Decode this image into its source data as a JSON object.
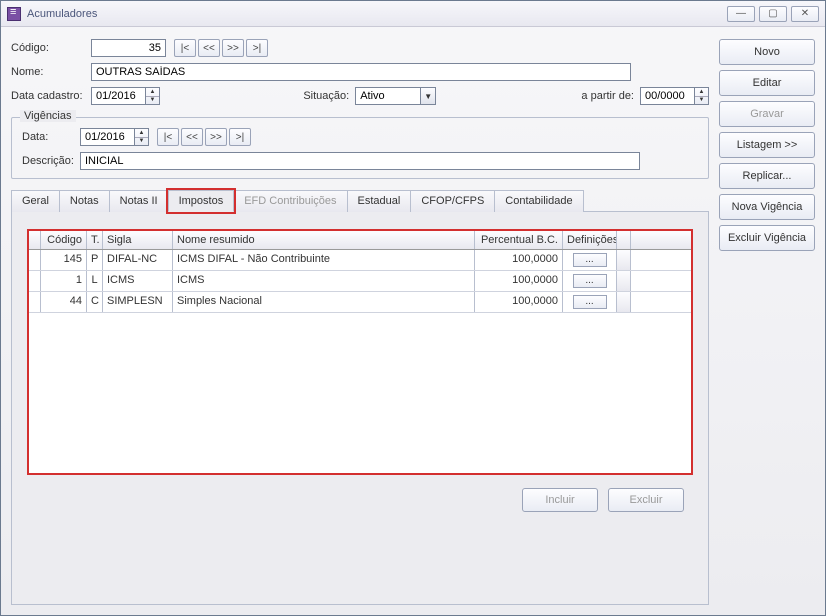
{
  "window": {
    "title": "Acumuladores"
  },
  "buttons": {
    "novo": "Novo",
    "editar": "Editar",
    "gravar": "Gravar",
    "listagem": "Listagem >>",
    "replicar": "Replicar...",
    "nova_vig": "Nova Vigência",
    "excluir_vig": "Excluir Vigência",
    "incluir": "Incluir",
    "excluir": "Excluir"
  },
  "nav": {
    "first": "|<",
    "prev": "<<",
    "next": ">>",
    "last": ">|"
  },
  "form": {
    "codigo_label": "Código:",
    "codigo": "35",
    "nome_label": "Nome:",
    "nome": "OUTRAS SAÍDAS",
    "data_cad_label": "Data cadastro:",
    "data_cad": "01/2016",
    "situacao_label": "Situação:",
    "situacao": "Ativo",
    "apartir_label": "a partir de:",
    "apartir": "00/0000"
  },
  "vig": {
    "legend": "Vigências",
    "data_label": "Data:",
    "data": "01/2016",
    "desc_label": "Descrição:",
    "desc": "INICIAL"
  },
  "tabs": {
    "geral": "Geral",
    "notas": "Notas",
    "notas2": "Notas II",
    "impostos": "Impostos",
    "efd": "EFD Contribuições",
    "estadual": "Estadual",
    "cfop": "CFOP/CFPS",
    "contab": "Contabilidade"
  },
  "grid": {
    "headers": {
      "codigo": "Código",
      "t": "T.",
      "sigla": "Sigla",
      "nome": "Nome resumido",
      "pct": "Percentual B.C.",
      "def": "Definições"
    },
    "rows": [
      {
        "codigo": "145",
        "t": "P",
        "sigla": "DIFAL-NC",
        "nome": "ICMS DIFAL - Não Contribuinte",
        "pct": "100,0000"
      },
      {
        "codigo": "1",
        "t": "L",
        "sigla": "ICMS",
        "nome": "ICMS",
        "pct": "100,0000"
      },
      {
        "codigo": "44",
        "t": "C",
        "sigla": "SIMPLESN",
        "nome": "Simples Nacional",
        "pct": "100,0000"
      }
    ]
  },
  "chart_data": {
    "type": "table",
    "columns": [
      "Código",
      "T.",
      "Sigla",
      "Nome resumido",
      "Percentual B.C."
    ],
    "rows": [
      [
        "145",
        "P",
        "DIFAL-NC",
        "ICMS DIFAL - Não Contribuinte",
        100.0
      ],
      [
        "1",
        "L",
        "ICMS",
        "ICMS",
        100.0
      ],
      [
        "44",
        "C",
        "SIMPLESN",
        "Simples Nacional",
        100.0
      ]
    ]
  }
}
